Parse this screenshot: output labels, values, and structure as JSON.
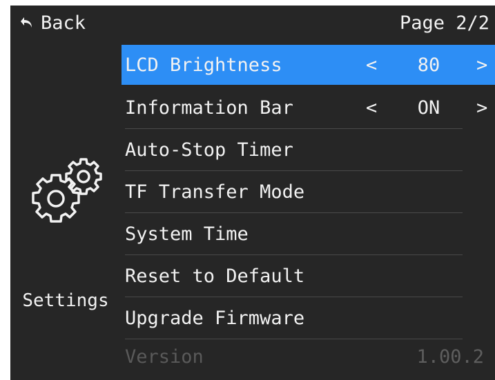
{
  "header": {
    "back_label": "Back",
    "page_indicator": "Page 2/2"
  },
  "sidebar": {
    "icon": "gears-icon",
    "label": "Settings"
  },
  "menu": {
    "items": [
      {
        "label": "LCD Brightness",
        "value": "80",
        "left_arrow": "<",
        "right_arrow": ">"
      },
      {
        "label": "Information Bar",
        "value": "ON",
        "left_arrow": "<",
        "right_arrow": ">"
      },
      {
        "label": "Auto-Stop Timer"
      },
      {
        "label": "TF Transfer Mode"
      },
      {
        "label": "System Time"
      },
      {
        "label": "Reset to Default"
      },
      {
        "label": "Upgrade Firmware"
      },
      {
        "label": "Version",
        "value": "1.00.2"
      }
    ]
  },
  "colors": {
    "background": "#262626",
    "selection": "#2d8ef5",
    "text": "#f2f2f2",
    "disabled_text": "#5a5a5a"
  }
}
